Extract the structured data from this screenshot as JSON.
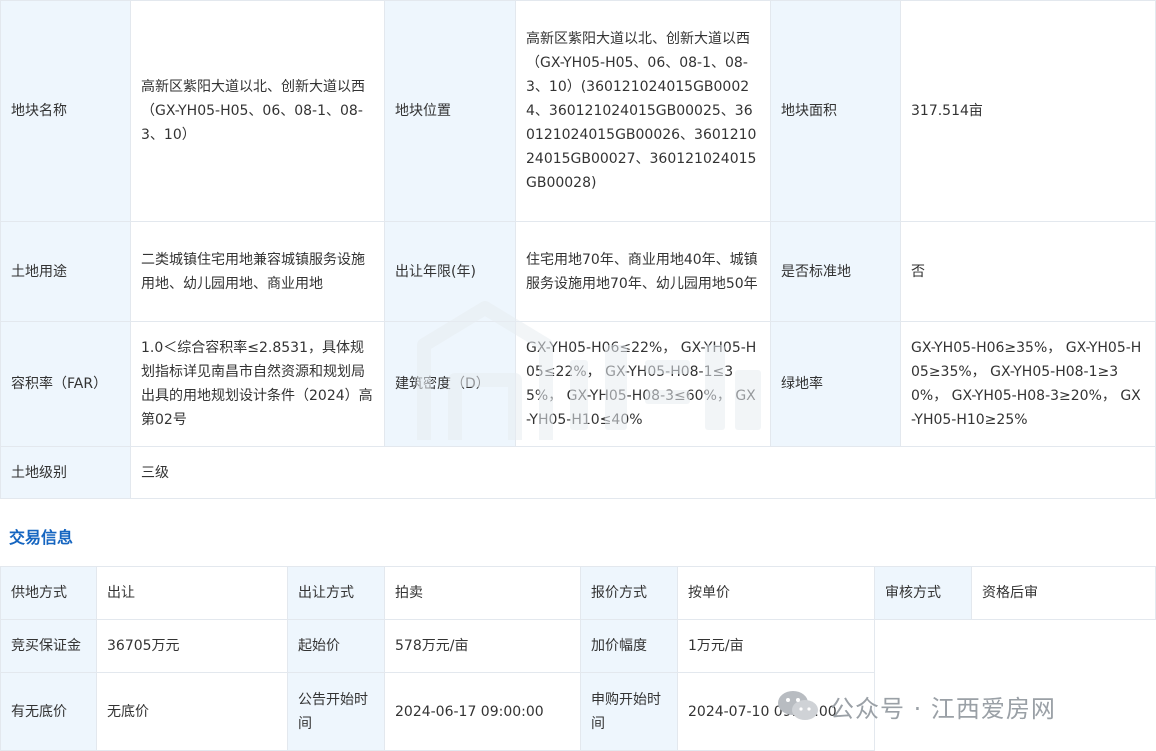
{
  "land": {
    "row1": {
      "name_label": "地块名称",
      "name_value": "高新区紫阳大道以北、创新大道以西（GX-YH05-H05、06、08-1、08-3、10）",
      "location_label": "地块位置",
      "location_value": "高新区紫阳大道以北、创新大道以西（GX-YH05-H05、06、08-1、08-3、10）(360121024015GB00024、360121024015GB00025、360121024015GB00026、360121024015GB00027、360121024015GB00028)",
      "area_label": "地块面积",
      "area_value": "317.514亩"
    },
    "row2": {
      "use_label": "土地用途",
      "use_value": "二类城镇住宅用地兼容城镇服务设施用地、幼儿园用地、商业用地",
      "term_label": "出让年限(年)",
      "term_value": "住宅用地70年、商业用地40年、城镇服务设施用地70年、幼儿园用地50年",
      "standard_label": "是否标准地",
      "standard_value": "否"
    },
    "row3": {
      "far_label": "容积率（FAR）",
      "far_value": "1.0＜综合容积率≤2.8531，具体规划指标详见南昌市自然资源和规划局出具的用地规划设计条件（2024）高第02号",
      "density_label": "建筑密度（D）",
      "density_value": "GX-YH05-H06≤22%， GX-YH05-H05≤22%， GX-YH05-H08-1≤35%， GX-YH05-H08-3≤60%， GX-YH05-H10≤40%",
      "green_label": "绿地率",
      "green_value": "GX-YH05-H06≥35%， GX-YH05-H05≥35%， GX-YH05-H08-1≥30%， GX-YH05-H08-3≥20%， GX-YH05-H10≥25%"
    },
    "row4": {
      "grade_label": "土地级别",
      "grade_value": "三级"
    }
  },
  "trade": {
    "title": "交易信息",
    "row1": {
      "supply_label": "供地方式",
      "supply_value": "出让",
      "transfer_label": "出让方式",
      "transfer_value": "拍卖",
      "quote_label": "报价方式",
      "quote_value": "按单价",
      "review_label": "审核方式",
      "review_value": "资格后审"
    },
    "row2": {
      "deposit_label": "竞买保证金",
      "deposit_value": "36705万元",
      "start_price_label": "起始价",
      "start_price_value": "578万元/亩",
      "increment_label": "加价幅度",
      "increment_value": "1万元/亩"
    },
    "row3": {
      "reserve_label": "有无底价",
      "reserve_value": "无底价",
      "notice_start_label": "公告开始时间",
      "notice_start_value": "2024-06-17 09:00:00",
      "apply_start_label": "申购开始时间",
      "apply_start_value": "2024-07-10 09:00:00"
    }
  },
  "watermark": {
    "logo_icon": "house-logo-icon"
  },
  "wechat": {
    "icon": "wechat-icon",
    "text": "公众号 · 江西爱房网"
  }
}
